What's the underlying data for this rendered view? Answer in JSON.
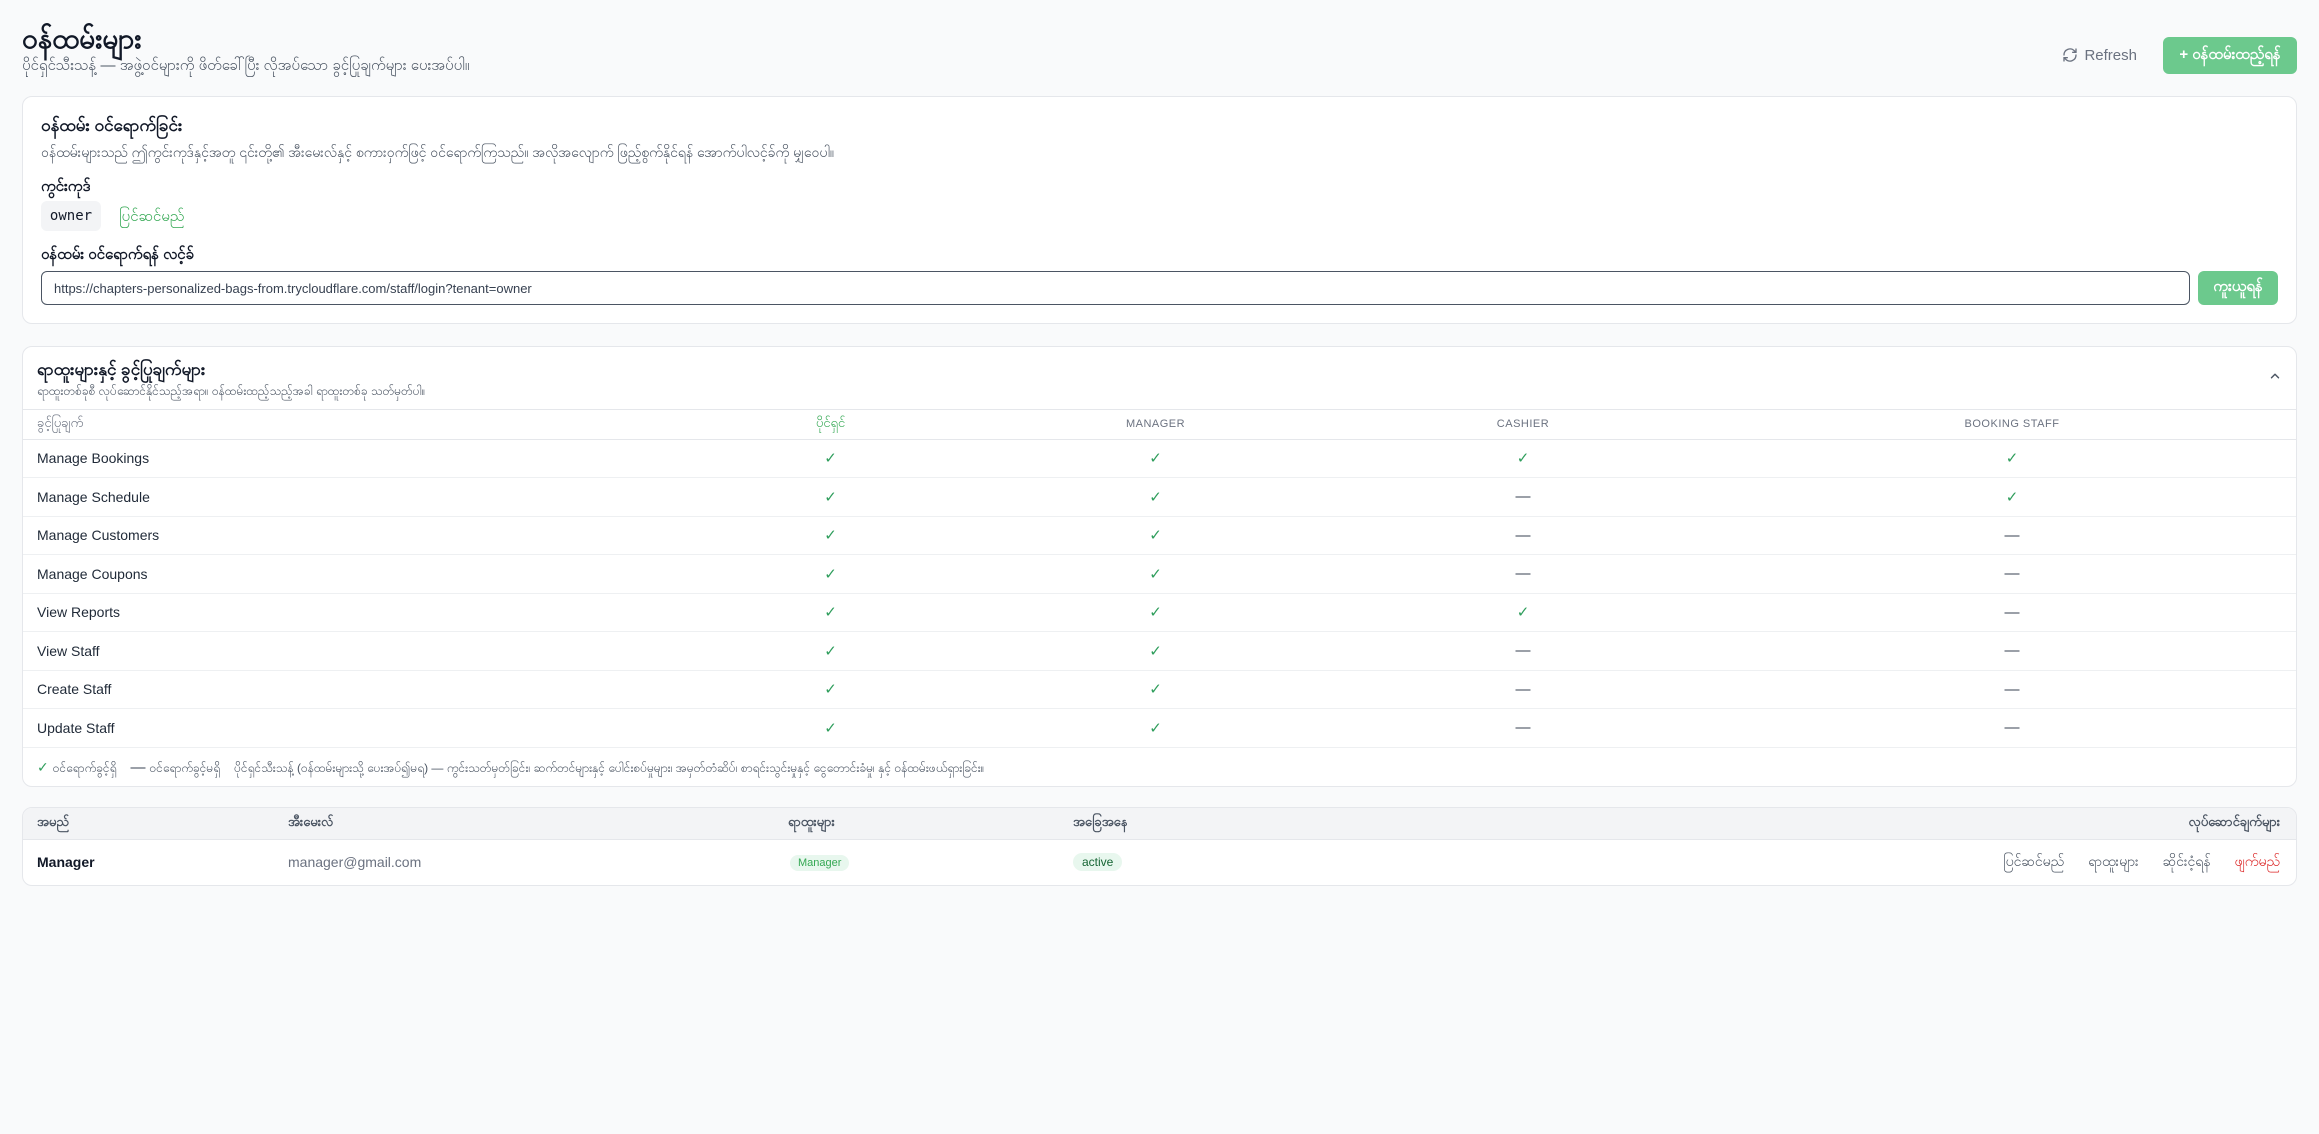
{
  "header": {
    "title": "ဝန်ထမ်းများ",
    "subtitle": "ပိုင်ရှင်သီးသန့် — အဖွဲ့ဝင်များကို ဖိတ်ခေါ်ပြီး လိုအပ်သော ခွင့်ပြုချက်များ ပေးအပ်ပါ။",
    "refresh_label": "Refresh",
    "add_staff_label": "+ ဝန်ထမ်းထည့်ရန်"
  },
  "login_card": {
    "title": "ဝန်ထမ်း ဝင်ရောက်ခြင်း",
    "description": "ဝန်ထမ်းများသည် ဤကွင်းကုဒ်နှင့်အတူ ၎င်းတို့၏ အီးမေးလ်နှင့် စကားဝှက်ဖြင့် ဝင်ရောက်ကြသည်။ အလိုအလျောက် ဖြည့်စွက်နိုင်ရန် အောက်ပါလင့်ခ်ကို မျှဝေပါ။",
    "shop_code_label": "ကွင်းကုဒ်",
    "shop_code": "owner",
    "edit_label": "ပြင်ဆင်မည်",
    "url_label": "ဝန်ထမ်း ဝင်ရောက်ရန် လင့်ခ်",
    "url_value": "https://chapters-personalized-bags-from.trycloudflare.com/staff/login?tenant=owner",
    "copy_label": "ကူးယူရန်"
  },
  "permissions": {
    "title": "ရာထူးများနှင့် ခွင့်ပြုချက်များ",
    "description": "ရာထူးတစ်ခုစီ လုပ်ဆောင်နိုင်သည့်အရာ။ ဝန်ထမ်းထည့်သည့်အခါ ရာထူးတစ်ခု သတ်မှတ်ပါ။",
    "columns": [
      "ခွင့်ပြုချက်",
      "ပိုင်ရှင်",
      "MANAGER",
      "CASHIER",
      "BOOKING STAFF"
    ],
    "rows": [
      {
        "name": "Manage Bookings",
        "owner": true,
        "manager": true,
        "cashier": true,
        "booking": true
      },
      {
        "name": "Manage Schedule",
        "owner": true,
        "manager": true,
        "cashier": false,
        "booking": true
      },
      {
        "name": "Manage Customers",
        "owner": true,
        "manager": true,
        "cashier": false,
        "booking": false
      },
      {
        "name": "Manage Coupons",
        "owner": true,
        "manager": true,
        "cashier": false,
        "booking": false
      },
      {
        "name": "View Reports",
        "owner": true,
        "manager": true,
        "cashier": true,
        "booking": false
      },
      {
        "name": "View Staff",
        "owner": true,
        "manager": true,
        "cashier": false,
        "booking": false
      },
      {
        "name": "Create Staff",
        "owner": true,
        "manager": true,
        "cashier": false,
        "booking": false
      },
      {
        "name": "Update Staff",
        "owner": true,
        "manager": true,
        "cashier": false,
        "booking": false
      }
    ],
    "legend_allowed": "ဝင်ရောက်ခွင့်ရှိ",
    "legend_denied": "ဝင်ရောက်ခွင့်မရှိ",
    "legend_note": "ပိုင်ရှင်သီးသန့် (ဝန်ထမ်းများသို့ ပေးအပ်၍မရ) — ကွင်းသတ်မှတ်ခြင်း၊ ဆက်တင်များနှင့် ပေါင်းစပ်မှုများ၊ အမှတ်တံဆိပ်၊ စာရင်းသွင်းမှုနှင့် ငွေတောင်းခံမှု၊ နှင့် ဝန်ထမ်းဖယ်ရှားခြင်း။"
  },
  "staff_table": {
    "columns": [
      "အမည်",
      "အီးမေးလ်",
      "ရာထူးများ",
      "အခြေအနေ",
      "လုပ်ဆောင်ချက်များ"
    ],
    "rows": [
      {
        "name": "Manager",
        "email": "manager@gmail.com",
        "role": "Manager",
        "status": "active",
        "actions": [
          "ပြင်ဆင်မည်",
          "ရာထူးများ",
          "ဆိုင်းငံ့ရန်",
          "ဖျက်မည်"
        ]
      }
    ]
  },
  "colors": {
    "accent": "#6cc98d",
    "check": "#2f9e5c",
    "danger": "#dc2626"
  },
  "icons": {
    "refresh": "refresh-icon",
    "collapse": "chevron-up-icon",
    "check": "check-icon",
    "dash": "dash-icon"
  }
}
